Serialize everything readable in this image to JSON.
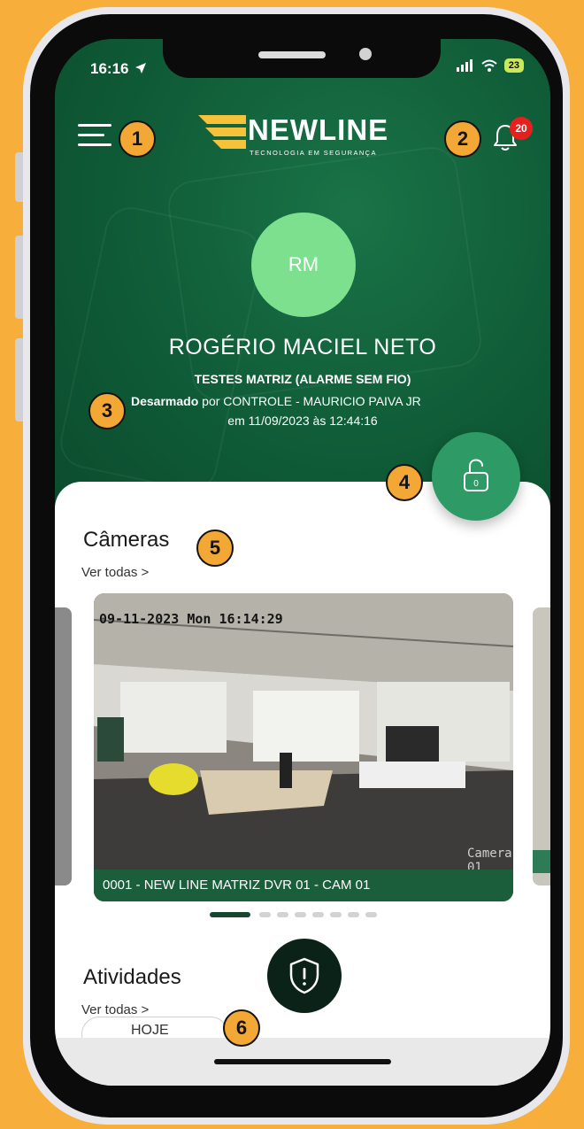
{
  "status_bar": {
    "time": "16:16",
    "battery": "23"
  },
  "header": {
    "logo_word": "NEWLINE",
    "logo_tagline": "TECNOLOGIA EM SEGURANÇA",
    "notification_count": "20"
  },
  "profile": {
    "initials": "RM",
    "name": "ROGÉRIO MACIEL NETO",
    "account": "TESTES MATRIZ (ALARME SEM FIO)",
    "status_bold": "Desarmado",
    "status_by": " por CONTROLE - MAURICIO PAIVA JR",
    "status_datetime": "em 11/09/2023 às 12:44:16"
  },
  "arm_button": {
    "icon": "lock-open-icon",
    "zone": "0"
  },
  "cameras": {
    "title": "Câmeras",
    "see_all": "Ver todas >",
    "items": [
      {
        "timestamp": "09-11-2023 Mon 16:14:29",
        "overlay_label": "Camera 01",
        "caption": "0001 - NEW LINE MATRIZ DVR 01 - CAM 01"
      }
    ],
    "page_count": 8,
    "active_page": 1
  },
  "activities": {
    "title": "Atividades",
    "see_all": "Ver todas >",
    "chip_text": "HOJE"
  },
  "panic_button": {
    "icon": "shield-alert-icon"
  },
  "markers": [
    "1",
    "2",
    "3",
    "4",
    "5",
    "6"
  ],
  "colors": {
    "outer_background": "#F7AE3B",
    "hero_green": "#0F5A37",
    "accent_green": "#2E9A66",
    "avatar_green": "#7CE08E",
    "badge_red": "#E5201F",
    "logo_yellow": "#F5C23A"
  }
}
